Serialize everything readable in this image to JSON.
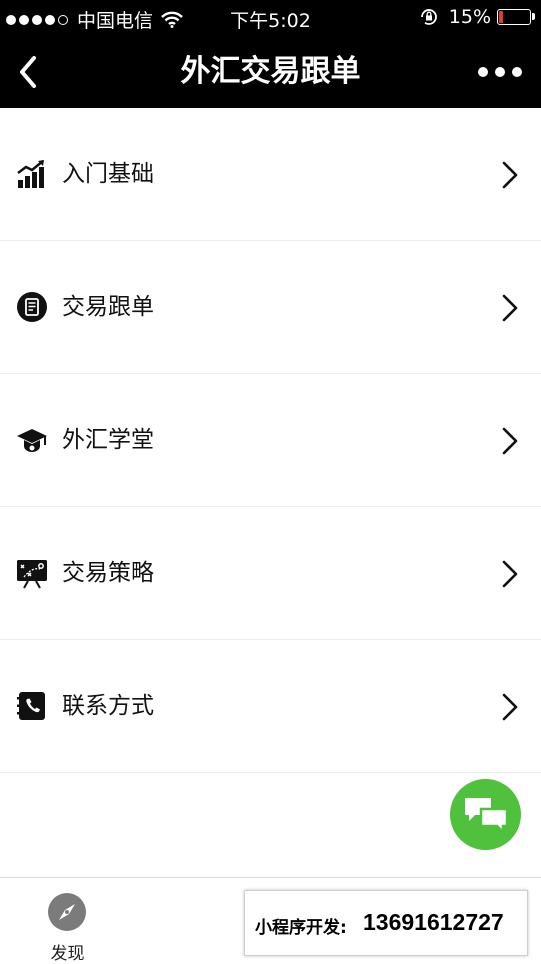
{
  "status_bar": {
    "carrier": "中国电信",
    "time": "下午5:02",
    "battery": "15%",
    "battery_level": 0.15
  },
  "nav": {
    "title": "外汇交易跟单"
  },
  "menu": [
    {
      "label": "入门基础",
      "icon": "chart-bars-icon"
    },
    {
      "label": "交易跟单",
      "icon": "document-icon"
    },
    {
      "label": "外汇学堂",
      "icon": "graduation-cap-icon"
    },
    {
      "label": "交易策略",
      "icon": "strategy-board-icon"
    },
    {
      "label": "联系方式",
      "icon": "phone-book-icon"
    }
  ],
  "tabbar": {
    "tab1_label": "发现"
  },
  "ad": {
    "label": "小程序开发:",
    "value": "13691612727"
  },
  "colors": {
    "nav_bg": "#000000",
    "fab": "#4fc13c",
    "battery_low": "#e53935"
  }
}
